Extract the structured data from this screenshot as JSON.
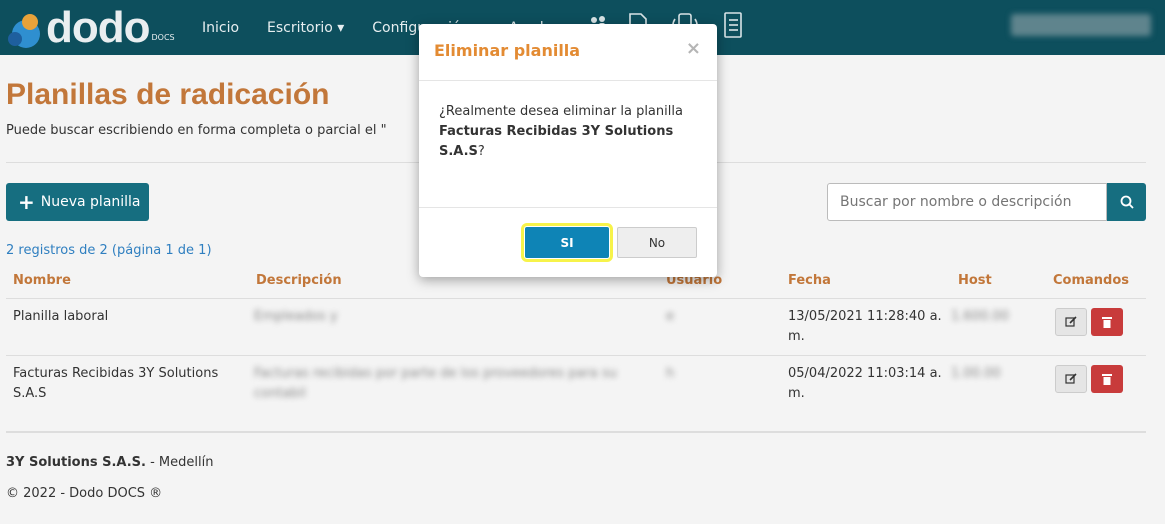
{
  "brand": {
    "name": "dodo",
    "sub": "DOCS"
  },
  "nav": {
    "items": [
      "Inicio",
      "Escritorio ▾",
      "Configuración ▾",
      "Ayuda ▾"
    ],
    "icons": [
      "people-icon",
      "pdf-file-icon",
      "mobile-icon",
      "document-list-icon"
    ],
    "user": "usuario"
  },
  "page": {
    "title": "Planillas de radicación",
    "hint": "Puede buscar escribiendo en forma completa o parcial el \""
  },
  "toolbar": {
    "new_label": "Nueva planilla",
    "search_placeholder": "Buscar por nombre o descripción"
  },
  "count": "2 registros de 2 (página 1 de 1)",
  "table": {
    "headers": [
      "Nombre",
      "Descripción",
      "Usuario",
      "Fecha",
      "Host",
      "Comandos"
    ],
    "rows": [
      {
        "nombre": "Planilla laboral",
        "descripcion": "Empleados y",
        "usuario": "e",
        "fecha": "13/05/2021 11:28:40 a. m.",
        "host": "1.600.00"
      },
      {
        "nombre": "Facturas Recibidas 3Y Solutions S.A.S",
        "descripcion": "Facturas recibidas por parte de los proveedores para su contabil",
        "usuario": "h",
        "fecha": "05/04/2022 11:03:14 a. m.",
        "host": "1.00.00"
      }
    ]
  },
  "footer": {
    "company": "3Y Solutions S.A.S.",
    "city": " - Medellín",
    "copyright": "© 2022 - Dodo DOCS ®"
  },
  "modal": {
    "title": "Eliminar planilla",
    "close": "×",
    "body_prefix": "¿Realmente desea eliminar la planilla ",
    "body_bold": "Facturas Recibidas 3Y Solutions S.A.S",
    "body_suffix": "?",
    "yes_label": "SI",
    "no_label": "No"
  },
  "colors": {
    "navbar": "#0d4f5d",
    "accent": "#c2773a",
    "modal_title": "#e38b33",
    "primary": "#166e80",
    "danger": "#c83b3b",
    "highlight": "#f7f34a"
  }
}
